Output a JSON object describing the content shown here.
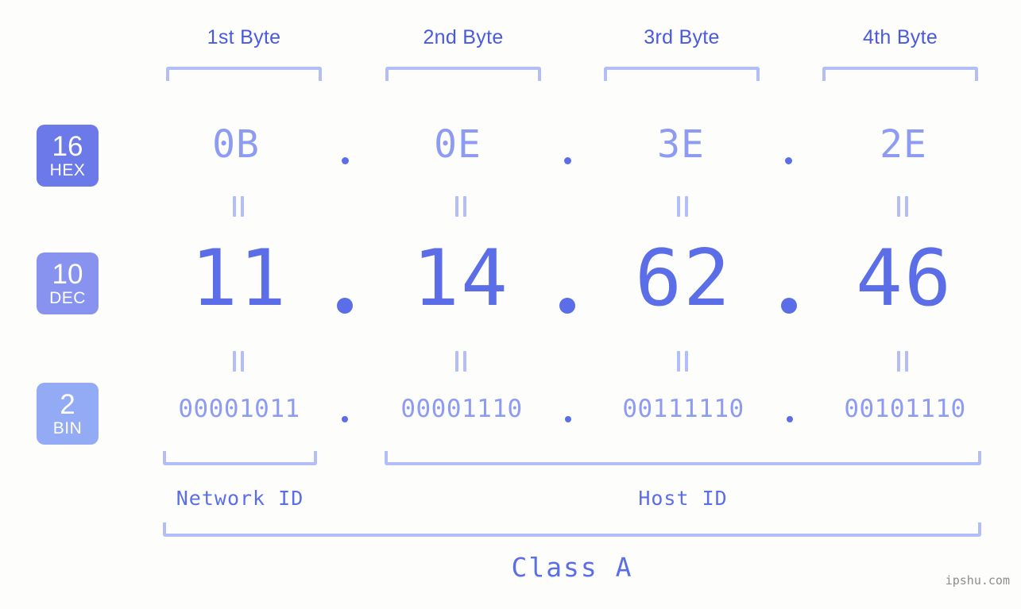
{
  "background_color": "#fdfefb",
  "accent_color": "#5b6ee8",
  "muted_accent_color": "#8d9bf2",
  "bracket_color": "#b3bdf8",
  "bases": [
    {
      "number": "16",
      "label": "HEX",
      "color": "#6b7ae8"
    },
    {
      "number": "10",
      "label": "DEC",
      "color": "#8892ef"
    },
    {
      "number": "2",
      "label": "BIN",
      "color": "#93aaf5"
    }
  ],
  "byte_headers": [
    {
      "label": "1st Byte"
    },
    {
      "label": "2nd Byte"
    },
    {
      "label": "3rd Byte"
    },
    {
      "label": "4th Byte"
    }
  ],
  "rows": {
    "hex": {
      "values": [
        "0B",
        "0E",
        "3E",
        "2E"
      ]
    },
    "dec": {
      "values": [
        "11",
        "14",
        "62",
        "46"
      ]
    },
    "bin": {
      "values": [
        "00001011",
        "00001110",
        "00111110",
        "00101110"
      ]
    }
  },
  "separators": {
    "hex": [
      ".",
      ".",
      "."
    ],
    "dec": [
      ".",
      ".",
      "."
    ],
    "bin": [
      ".",
      ".",
      "."
    ]
  },
  "equality_marks": {
    "glyph": "=",
    "count_top": 4,
    "count_bottom": 4
  },
  "segments": {
    "network_id": {
      "label": "Network ID"
    },
    "host_id": {
      "label": "Host ID"
    },
    "class": {
      "label": "Class A"
    }
  },
  "watermark": {
    "text": "ipshu.com"
  }
}
